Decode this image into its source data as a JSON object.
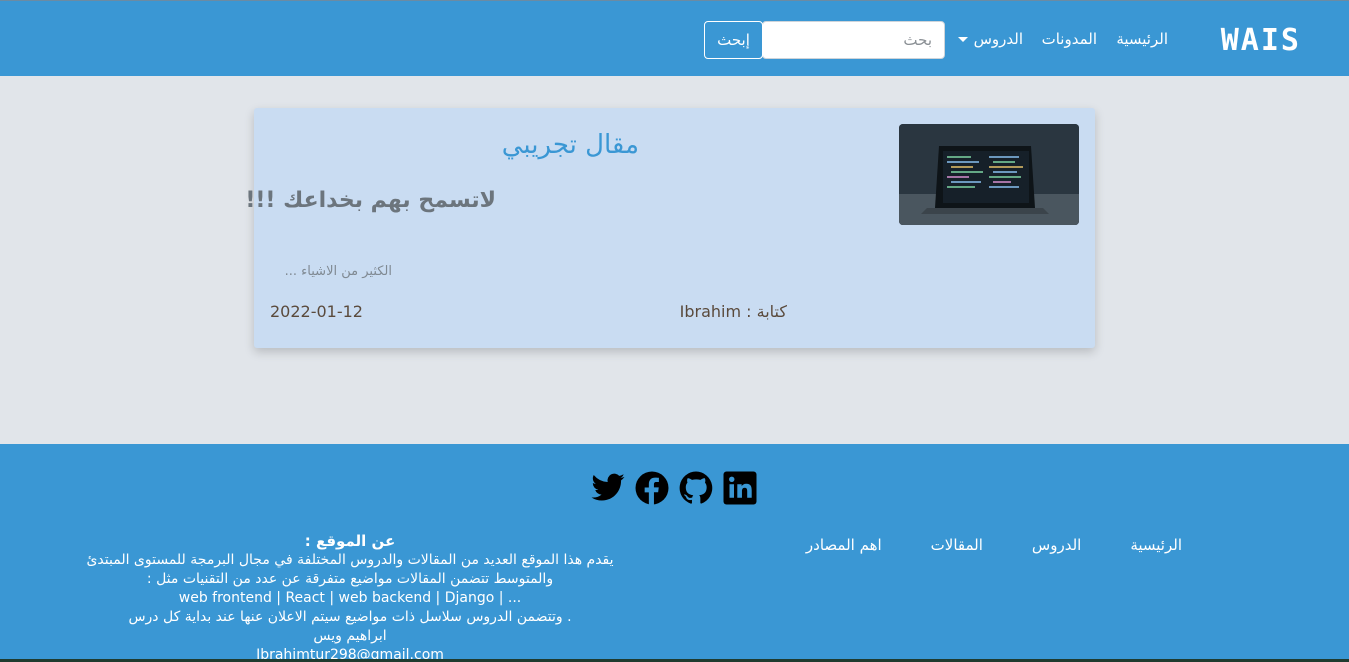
{
  "nav": {
    "brand": "WAIS",
    "home": "الرئيسية",
    "blogs": "المدونات",
    "lessons": "الدروس",
    "search_placeholder": "بحث",
    "search_button": "إبحث"
  },
  "article": {
    "title": "مقال تجريبي",
    "subtitle": "لاتسمح بهم بخداعك !!!",
    "excerpt": "الكثير من الاشياء ...",
    "author": "كتابة : Ibrahim",
    "date": "2022-01-12"
  },
  "footer": {
    "links": [
      "الرئيسية",
      "الدروس",
      "المقالات",
      "اهم المصادر"
    ],
    "about_title": "عن الموقع :",
    "about_lines": [
      "يقدم هذا الموقع العديد من المقالات والدروس المختلفة في  مجال البرمجة للمستوى المبتدئ",
      "والمتوسط تتضمن المقالات مواضيع متفرقة عن عدد من التقنيات مثل :",
      "web frontend | React | web backend | Django | ...",
      ". وتتضمن الدروس سلاسل ذات مواضيع سيتم الاعلان عنها عند بداية كل درس",
      "ابراهيم ويس",
      "Ibrahimtur298@gmail.com"
    ],
    "socials": [
      "twitter-icon",
      "facebook-icon",
      "github-icon",
      "linkedin-icon"
    ]
  },
  "colors": {
    "primary": "#3a97d4",
    "card_bg": "#c9dcf2",
    "page_bg": "#e1e5ea"
  }
}
